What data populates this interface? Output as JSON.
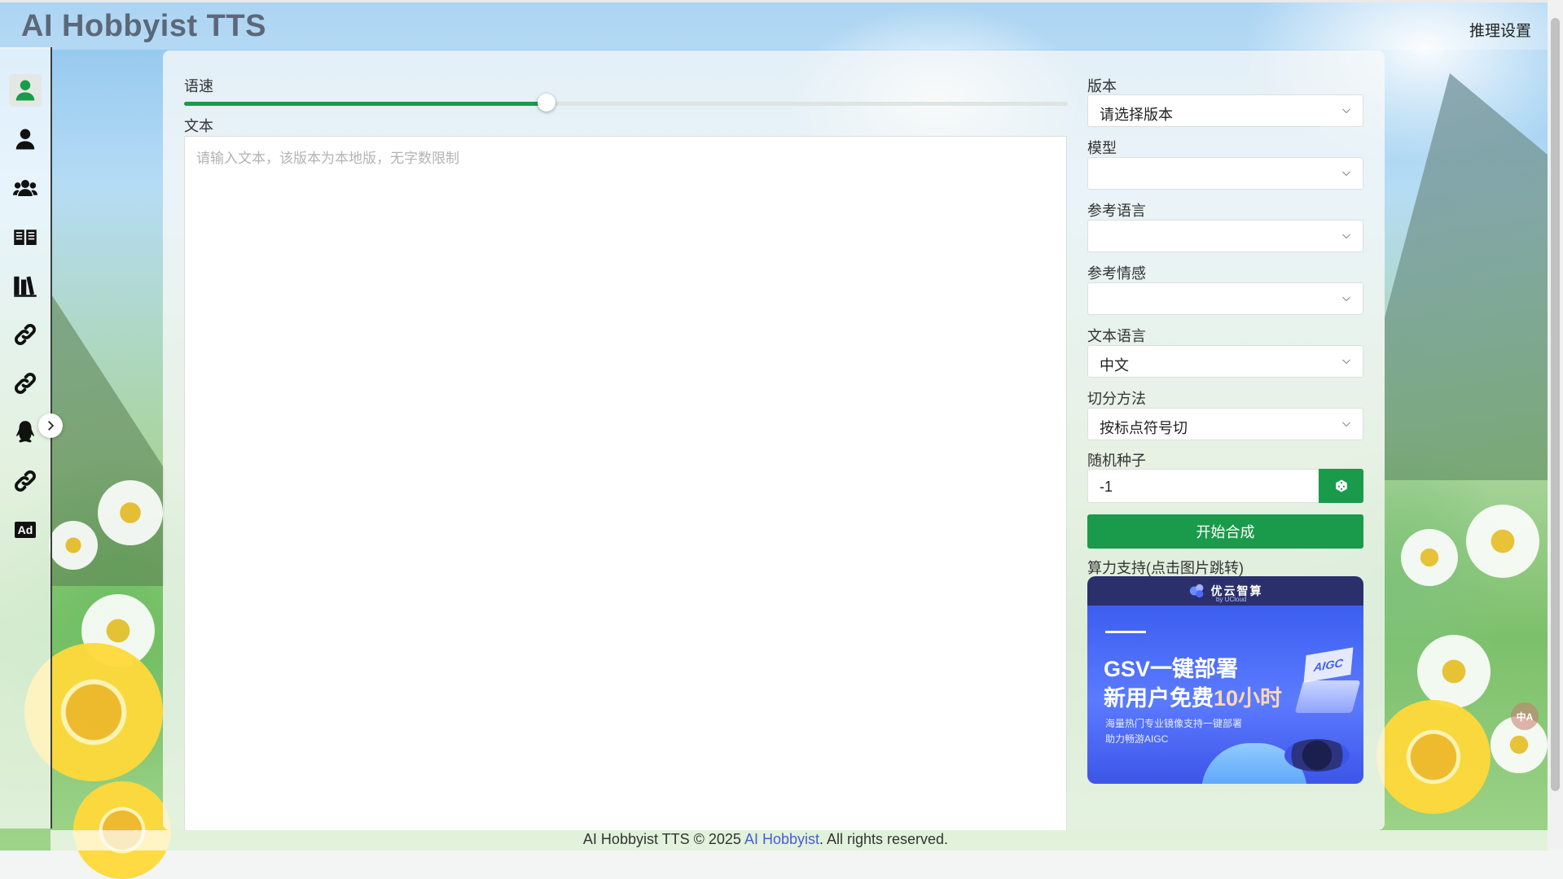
{
  "app": {
    "title": "AI Hobbyist TTS"
  },
  "header": {
    "settings_label": "推理设置"
  },
  "sidebar": {
    "items": [
      {
        "icon": "user-icon",
        "active": true
      },
      {
        "icon": "user-icon"
      },
      {
        "icon": "users-icon"
      },
      {
        "icon": "book-open-icon"
      },
      {
        "icon": "library-icon"
      },
      {
        "icon": "link-icon"
      },
      {
        "icon": "link-icon"
      },
      {
        "icon": "qq-penguin-icon"
      },
      {
        "icon": "link-icon"
      },
      {
        "icon": "ad-icon",
        "text": "Ad"
      }
    ],
    "expand_icon": "chevron-right-icon"
  },
  "form": {
    "speed": {
      "label": "语速",
      "fraction": 0.41
    },
    "text": {
      "label": "文本",
      "placeholder": "请输入文本，该版本为本地版，无字数限制",
      "value": ""
    },
    "version": {
      "label": "版本",
      "value": "请选择版本"
    },
    "model": {
      "label": "模型",
      "value": ""
    },
    "ref_lang": {
      "label": "参考语言",
      "value": ""
    },
    "ref_emotion": {
      "label": "参考情感",
      "value": ""
    },
    "text_lang": {
      "label": "文本语言",
      "value": "中文"
    },
    "split_method": {
      "label": "切分方法",
      "value": "按标点符号切"
    },
    "seed": {
      "label": "随机种子",
      "value": "-1",
      "button_icon": "dice-icon"
    },
    "start_button": "开始合成",
    "compute_label": "算力支持(点击图片跳转)"
  },
  "ad": {
    "brand": "优云智算",
    "by": "by UCloud",
    "headline1": "GSV一键部署",
    "headline2_prefix": "新用户免费",
    "headline2_highlight": "10小时",
    "sub1": "海量热门专业镜像支持一键部署",
    "sub2": "助力畅游AIGC",
    "badge": "AIGC"
  },
  "footer": {
    "prefix": "AI Hobbyist TTS © 2025 ",
    "link": "AI Hobbyist",
    "suffix": ". All rights reserved."
  },
  "colors": {
    "accent": "#1a9b4b",
    "title": "#5b6878",
    "link": "#4b5bd6"
  }
}
